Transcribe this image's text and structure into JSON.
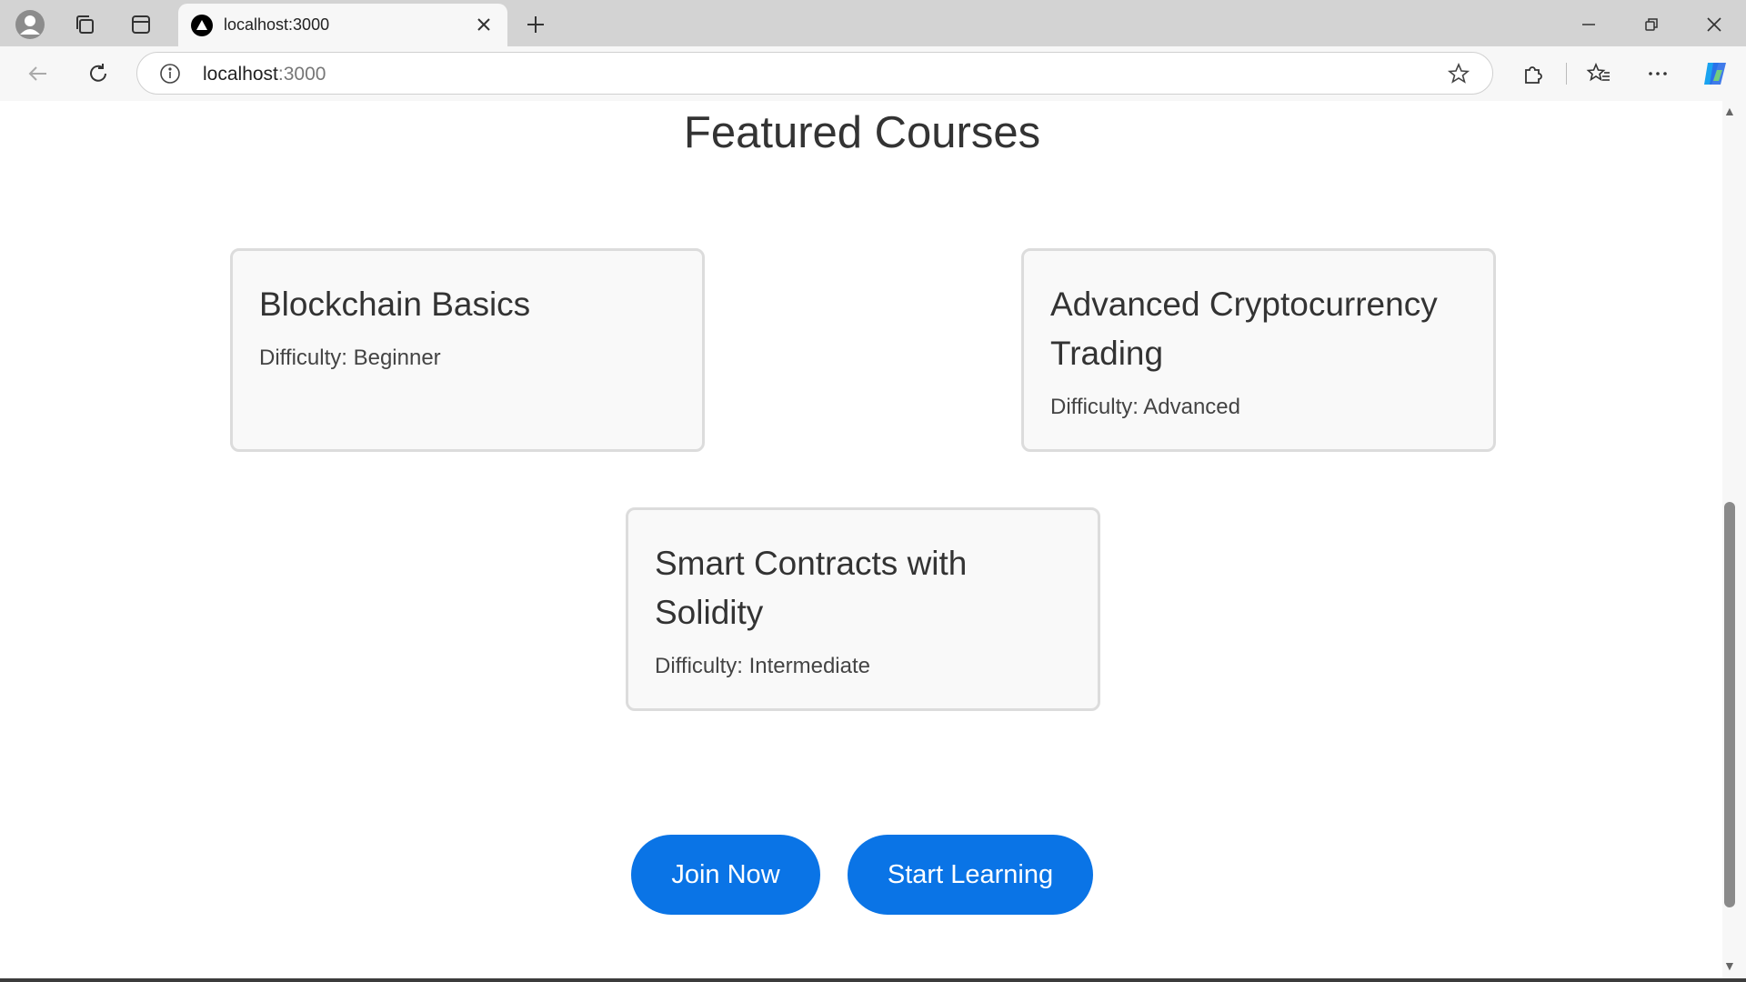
{
  "browser": {
    "tab_title": "localhost:3000",
    "url_host": "localhost",
    "url_port": ":3000"
  },
  "page": {
    "title": "Featured Courses",
    "courses": [
      {
        "title": "Blockchain Basics",
        "difficulty": "Difficulty: Beginner"
      },
      {
        "title": "Advanced Cryptocurrency Trading",
        "difficulty": "Difficulty: Advanced"
      },
      {
        "title": "Smart Contracts with Solidity",
        "difficulty": "Difficulty: Intermediate"
      }
    ],
    "buttons": {
      "join": "Join Now",
      "start": "Start Learning"
    }
  },
  "colors": {
    "primary_button": "#0a74e6",
    "card_border": "#dcdcdc"
  }
}
